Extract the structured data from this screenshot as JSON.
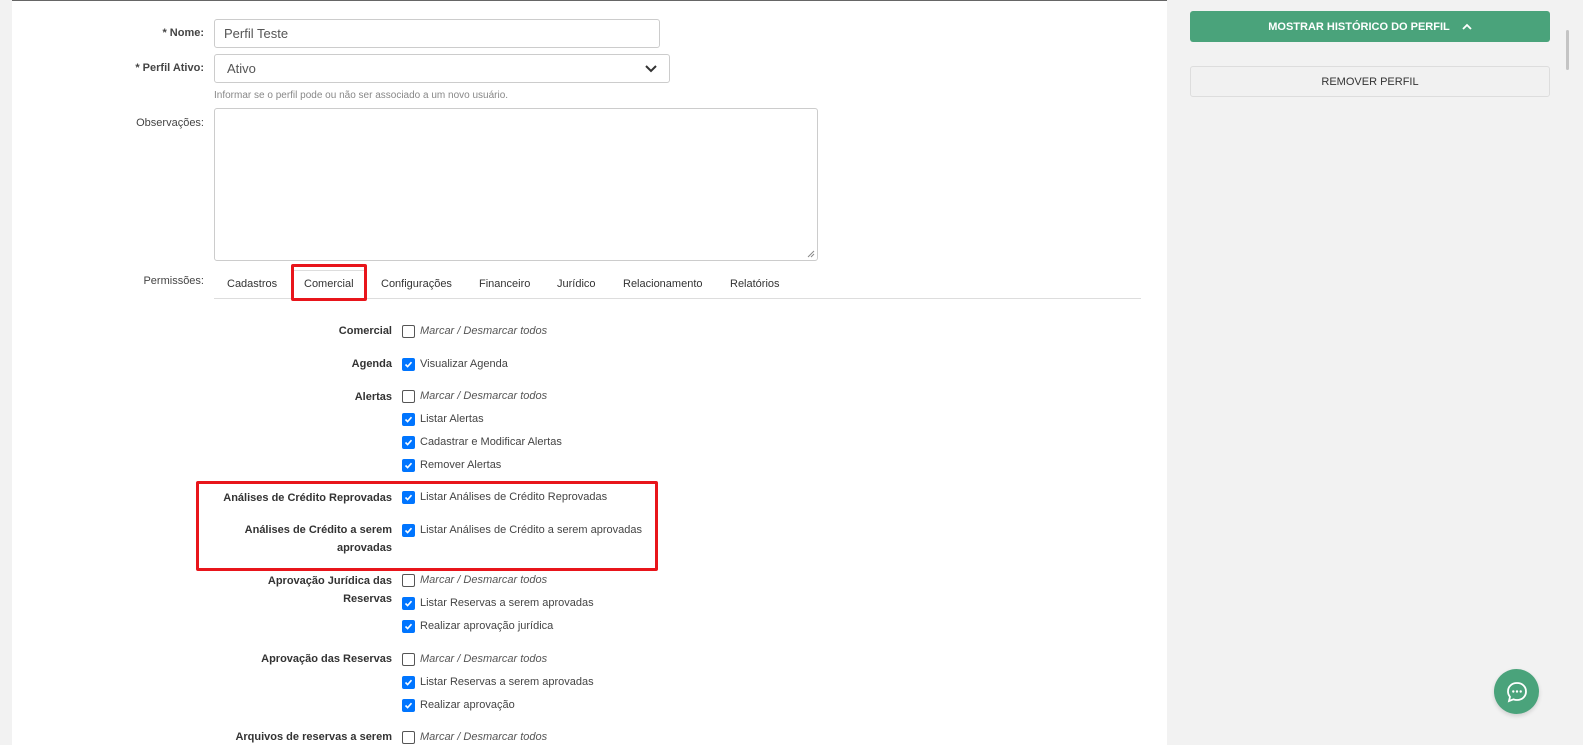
{
  "form": {
    "name_label": "* Nome:",
    "name_value": "Perfil Teste",
    "active_label": "* Perfil Ativo:",
    "active_value": "Ativo",
    "active_help": "Informar se o perfil pode ou não ser associado a um novo usuário.",
    "notes_label": "Observações:",
    "permissions_label": "Permissões:"
  },
  "tabs": [
    "Cadastros",
    "Comercial",
    "Configurações",
    "Financeiro",
    "Jurídico",
    "Relacionamento",
    "Relatórios"
  ],
  "active_tab": "Comercial",
  "permissions": [
    {
      "label": "Comercial",
      "items": [
        {
          "text": "Marcar / Desmarcar todos",
          "checked": false,
          "toggle_all": true
        }
      ]
    },
    {
      "label": "Agenda",
      "items": [
        {
          "text": "Visualizar Agenda",
          "checked": true
        }
      ]
    },
    {
      "label": "Alertas",
      "items": [
        {
          "text": "Marcar / Desmarcar todos",
          "checked": false,
          "toggle_all": true
        },
        {
          "text": "Listar Alertas",
          "checked": true
        },
        {
          "text": "Cadastrar e Modificar Alertas",
          "checked": true
        },
        {
          "text": "Remover Alertas",
          "checked": true
        }
      ]
    },
    {
      "label": "Análises de Crédito Reprovadas",
      "items": [
        {
          "text": "Listar Análises de Crédito Reprovadas",
          "checked": true
        }
      ]
    },
    {
      "label_lines": [
        "Análises de Crédito a serem",
        "aprovadas"
      ],
      "items": [
        {
          "text": "Listar Análises de Crédito a serem aprovadas",
          "checked": true
        }
      ]
    },
    {
      "label_lines": [
        "Aprovação Jurídica das",
        "Reservas"
      ],
      "items": [
        {
          "text": "Marcar / Desmarcar todos",
          "checked": false,
          "toggle_all": true
        },
        {
          "text": "Listar Reservas a serem aprovadas",
          "checked": true
        },
        {
          "text": "Realizar aprovação jurídica",
          "checked": true
        }
      ]
    },
    {
      "label": "Aprovação das Reservas",
      "items": [
        {
          "text": "Marcar / Desmarcar todos",
          "checked": false,
          "toggle_all": true
        },
        {
          "text": "Listar Reservas a serem aprovadas",
          "checked": true
        },
        {
          "text": "Realizar aprovação",
          "checked": true
        }
      ]
    },
    {
      "label": "Arquivos de reservas a serem",
      "items": [
        {
          "text": "Marcar / Desmarcar todos",
          "checked": false,
          "toggle_all": true
        }
      ]
    }
  ],
  "sidebar": {
    "history_button": "MOSTRAR HISTÓRICO DO PERFIL",
    "remove_button": "REMOVER PERFIL"
  },
  "colors": {
    "accent_green": "#4aa37b",
    "highlight_red": "#e8151b",
    "checkbox_blue": "#0075ff"
  },
  "icons": {
    "chevron_up": "chevron-up-icon",
    "chevron_down": "chevron-down-icon",
    "chat": "chat-icon"
  }
}
